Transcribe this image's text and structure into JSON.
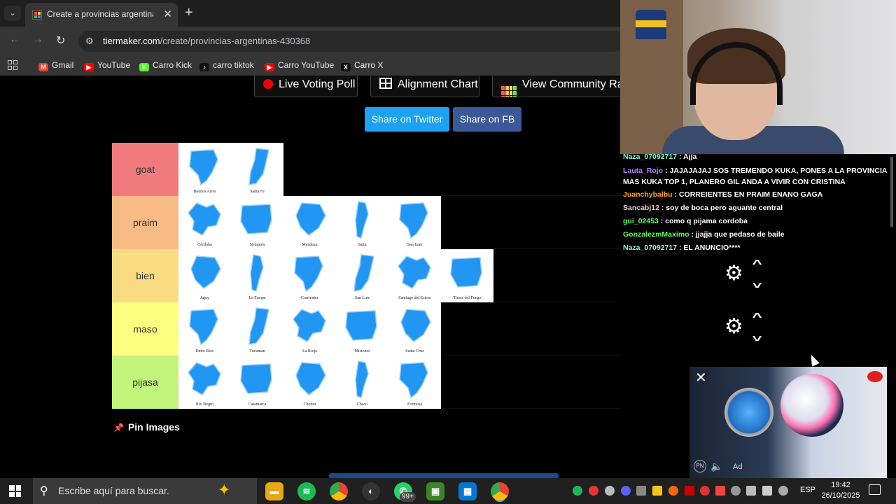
{
  "browser": {
    "tab_title": "Create a provincias argentinas T",
    "url_domain": "tiermaker.com",
    "url_path": "/create/provincias-argentinas-430368",
    "bookmarks": [
      {
        "label": "Gmail",
        "color": "#ea4335",
        "glyph": "M"
      },
      {
        "label": "YouTube",
        "color": "#ff0000",
        "glyph": "▶"
      },
      {
        "label": "Carro Kick",
        "color": "#53fc18",
        "glyph": "K"
      },
      {
        "label": "carro tiktok",
        "color": "#111111",
        "glyph": "♪"
      },
      {
        "label": "Carro YouTube",
        "color": "#ff0000",
        "glyph": "▶"
      },
      {
        "label": "Carro X",
        "color": "#111111",
        "glyph": "X"
      }
    ]
  },
  "page": {
    "buttons": {
      "live_voting": "Live Voting Poll",
      "alignment": "Alignment Chart",
      "community": "View Community Ran"
    },
    "share_twitter": "Share on Twitter",
    "share_fb": "Share on FB",
    "pin_images": "Pin Images",
    "tiers": [
      {
        "label": "goat",
        "color": "#f07a7e",
        "items": [
          "Buenos Aires",
          "Santa Fe"
        ]
      },
      {
        "label": "praim",
        "color": "#f8bb86",
        "items": [
          "Córdoba",
          "Neuquén",
          "Mendoza",
          "Salta",
          "San Juan"
        ]
      },
      {
        "label": "bien",
        "color": "#f9dc82",
        "items": [
          "Jujuy",
          "La Pampa",
          "Corrientes",
          "San Luis",
          "Santiago del Estero",
          "Tierra del Fuego"
        ]
      },
      {
        "label": "maso",
        "color": "#fdfd80",
        "items": [
          "Entre Ríos",
          "Tucumán",
          "La Rioja",
          "Misiones",
          "Santa Cruz"
        ]
      },
      {
        "label": "pijasa",
        "color": "#c2f47c",
        "items": [
          "Río Negro",
          "Catamarca",
          "Chubut",
          "Chaco",
          "Formosa"
        ]
      }
    ]
  },
  "chat": {
    "messages": [
      {
        "user": "Naza_07092717",
        "user_color": "#7fffd4",
        "text": "Ajja"
      },
      {
        "user": "Lauta_Rojo",
        "user_color": "#b57bff",
        "text": "JAJAJAJAJ SOS TREMENDO KUKA, PONES A LA PROVINCIA MAS KUKA TOP 1, PLANERO GIL ANDA A VIVIR CON CRISTINA"
      },
      {
        "user": "Juanchybalbu",
        "user_color": "#ffa500",
        "text": "CORREIENTES EN PRAIM ENANO GAGA"
      },
      {
        "user": "Sancabj12",
        "user_color": "#f0c8c8",
        "text": "soy de boca pero aguante central"
      },
      {
        "user": "gui_02453",
        "user_color": "#5cff5c",
        "text": "como q pijama cordoba"
      },
      {
        "user": "GonzalezmMaximo",
        "user_color": "#5cff5c",
        "text": "jjajja que pedaso de baile"
      },
      {
        "user": "Naza_07092717",
        "user_color": "#7fffd4",
        "text": "EL ANUNCIO****"
      }
    ]
  },
  "ad": {
    "tag": "Ad",
    "pn": "PN"
  },
  "taskbar": {
    "search_placeholder": "Escribe aquí para buscar.",
    "badge": "99+",
    "language": "ESP",
    "time": "19:42",
    "date": "26/10/2025"
  },
  "colors": {
    "accent_twitter": "#1da1f2",
    "accent_fb": "#3b5998",
    "province_blue": "#2196f3"
  }
}
